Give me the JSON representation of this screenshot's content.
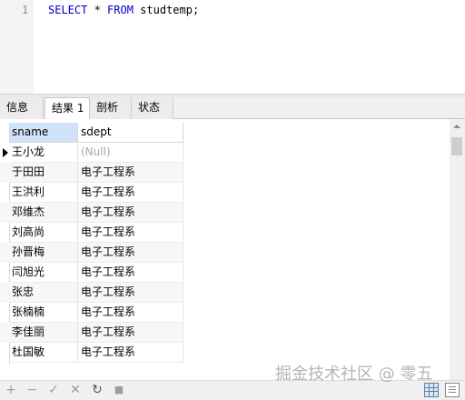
{
  "editor": {
    "line_number": "1",
    "code": {
      "kw1": "SELECT",
      "mid1": " * ",
      "kw2": "FROM",
      "rest": " studtemp;"
    }
  },
  "tabs": [
    {
      "label": "信息"
    },
    {
      "label": "结果 1"
    },
    {
      "label": "剖析"
    },
    {
      "label": "状态"
    }
  ],
  "grid": {
    "columns": [
      "sname",
      "sdept"
    ],
    "rows": [
      [
        "王小龙",
        "(Null)"
      ],
      [
        "于田田",
        "电子工程系"
      ],
      [
        "王洪利",
        "电子工程系"
      ],
      [
        "邓维杰",
        "电子工程系"
      ],
      [
        "刘高尚",
        "电子工程系"
      ],
      [
        "孙晋梅",
        "电子工程系"
      ],
      [
        "闫旭光",
        "电子工程系"
      ],
      [
        "张忠",
        "电子工程系"
      ],
      [
        "张楠楠",
        "电子工程系"
      ],
      [
        "李佳丽",
        "电子工程系"
      ],
      [
        "杜国敏",
        "电子工程系"
      ]
    ]
  },
  "toolbar": {
    "add": "+",
    "remove": "−",
    "apply": "✓",
    "discard": "✕",
    "refresh": "↻",
    "stop": "■"
  },
  "watermark": "掘金技术社区 @ 零五"
}
